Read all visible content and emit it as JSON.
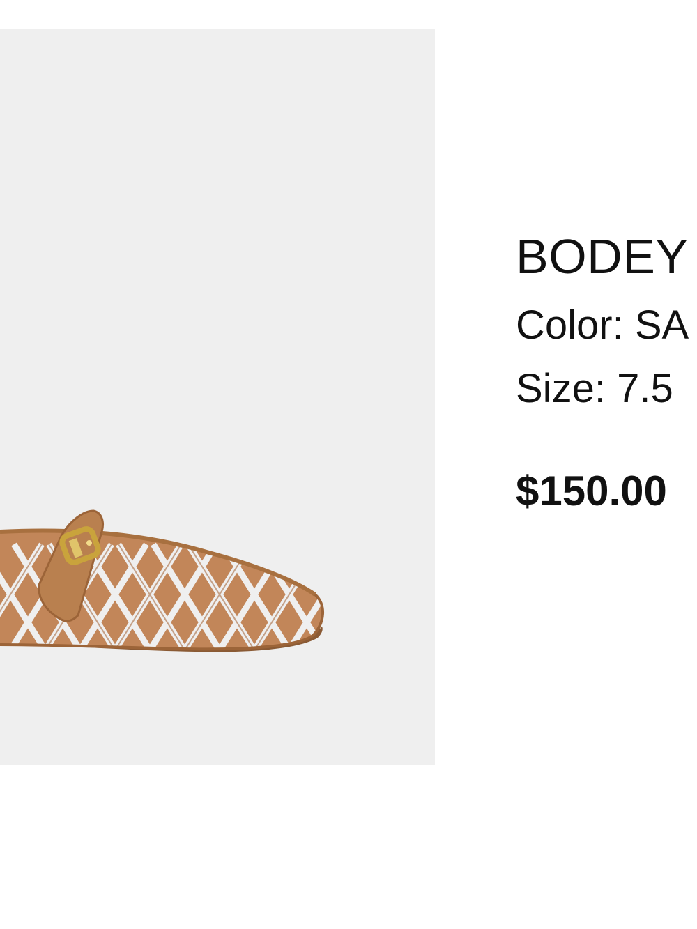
{
  "product": {
    "image_alt": "Tan woven leather Mary Jane flat with gold buckle strap",
    "name": "BODEY",
    "color_label": "Color:",
    "color_value": "SA",
    "size_label": "Size:",
    "size_value": "7.5",
    "price": "$150.00"
  },
  "colors": {
    "image_background": "#efefef",
    "shoe_leather": "#b87a4b",
    "buckle_gold": "#c9a33c",
    "text": "#111111"
  }
}
